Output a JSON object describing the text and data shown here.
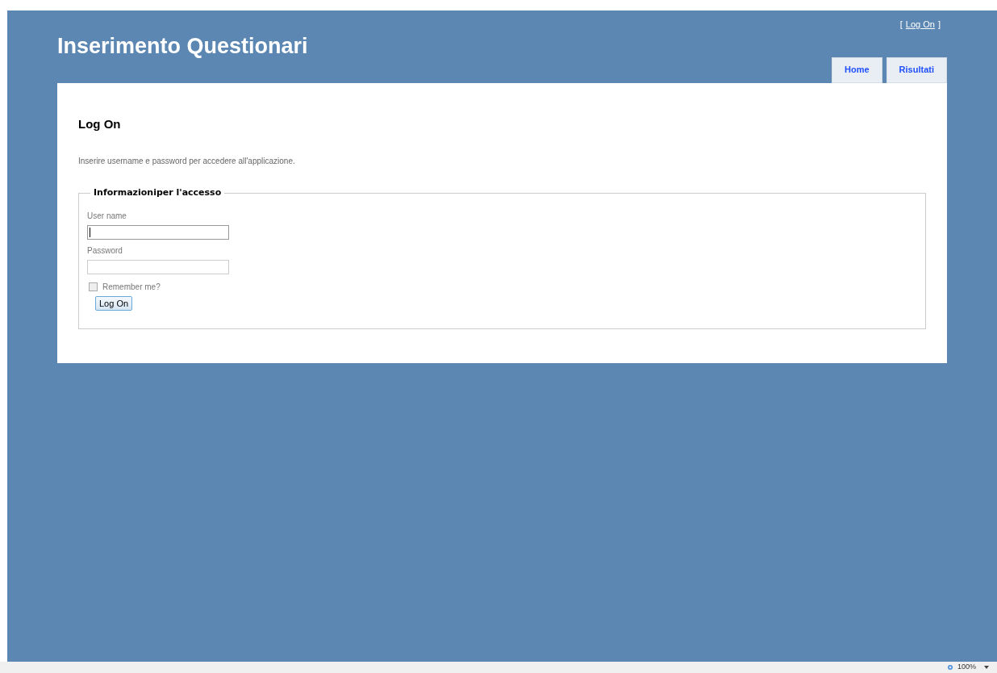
{
  "header": {
    "title": "Inserimento Questionari",
    "login_link": {
      "open": "[",
      "label": "Log On",
      "close": "]"
    },
    "menu": [
      {
        "label": "Home"
      },
      {
        "label": "Risultati"
      }
    ]
  },
  "main": {
    "heading": "Log On",
    "intro": "Inserire username e password per accedere all'applicazione.",
    "fieldset": {
      "legend": "Informazioniper l'accesso",
      "fields": [
        {
          "label": "User name",
          "focused": true
        },
        {
          "label": "Password",
          "focused": false
        }
      ],
      "remember": {
        "label": "Remember me?",
        "checked": false
      },
      "submit": "Log On"
    }
  },
  "status_bar": {
    "zoom": "100%"
  }
}
